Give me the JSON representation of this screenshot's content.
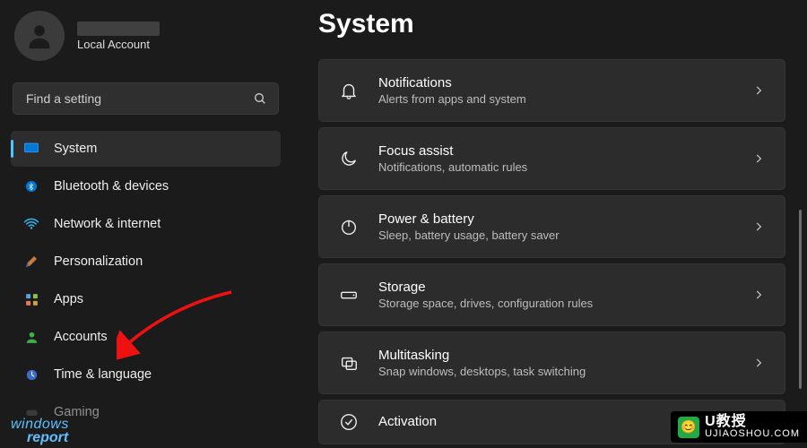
{
  "profile": {
    "subtitle": "Local Account"
  },
  "search": {
    "placeholder": "Find a setting"
  },
  "nav": {
    "items": [
      {
        "label": "System"
      },
      {
        "label": "Bluetooth & devices"
      },
      {
        "label": "Network & internet"
      },
      {
        "label": "Personalization"
      },
      {
        "label": "Apps"
      },
      {
        "label": "Accounts"
      },
      {
        "label": "Time & language"
      },
      {
        "label": "Gaming"
      }
    ]
  },
  "page": {
    "title": "System"
  },
  "panels": [
    {
      "title": "Notifications",
      "desc": "Alerts from apps and system"
    },
    {
      "title": "Focus assist",
      "desc": "Notifications, automatic rules"
    },
    {
      "title": "Power & battery",
      "desc": "Sleep, battery usage, battery saver"
    },
    {
      "title": "Storage",
      "desc": "Storage space, drives, configuration rules"
    },
    {
      "title": "Multitasking",
      "desc": "Snap windows, desktops, task switching"
    },
    {
      "title": "Activation",
      "desc": ""
    }
  ],
  "watermarks": {
    "left_top": "windows",
    "left_bottom": "report",
    "right_main": "U教授",
    "right_sub": "UJIAOSHOU.COM"
  }
}
